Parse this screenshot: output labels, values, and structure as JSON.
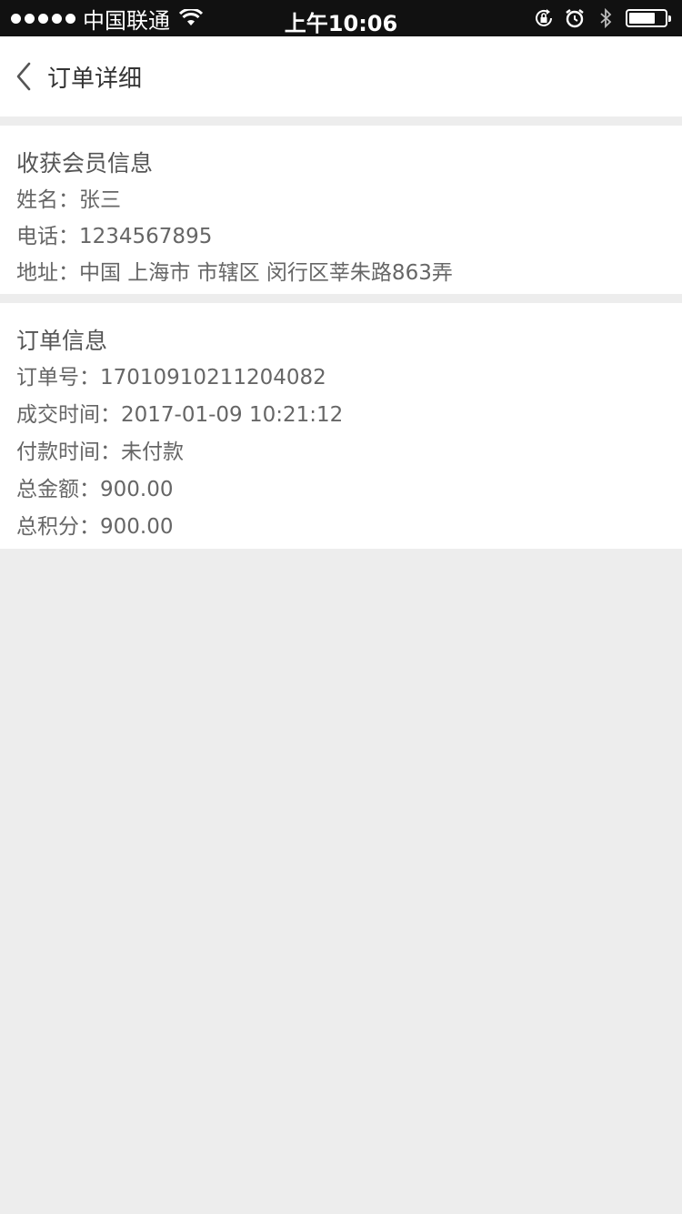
{
  "status_bar": {
    "carrier": "中国联通",
    "time": "上午10:06"
  },
  "nav": {
    "title": "订单详细"
  },
  "member_info": {
    "title": "收获会员信息",
    "name_label": "姓名：",
    "name": "张三",
    "phone_label": "电话：",
    "phone": "1234567895",
    "address_label": "地址：",
    "address": "中国 上海市 市辖区 闵行区莘朱路863弄"
  },
  "order_info": {
    "title": "订单信息",
    "order_no_label": "订单号：",
    "order_no": "17010910211204082",
    "deal_time_label": "成交时间：",
    "deal_time": "2017-01-09 10:21:12",
    "pay_time_label": "付款时间：",
    "pay_time": "未付款",
    "total_amount_label": "总金额：",
    "total_amount": "900.00",
    "total_points_label": "总积分：",
    "total_points": "900.00"
  }
}
